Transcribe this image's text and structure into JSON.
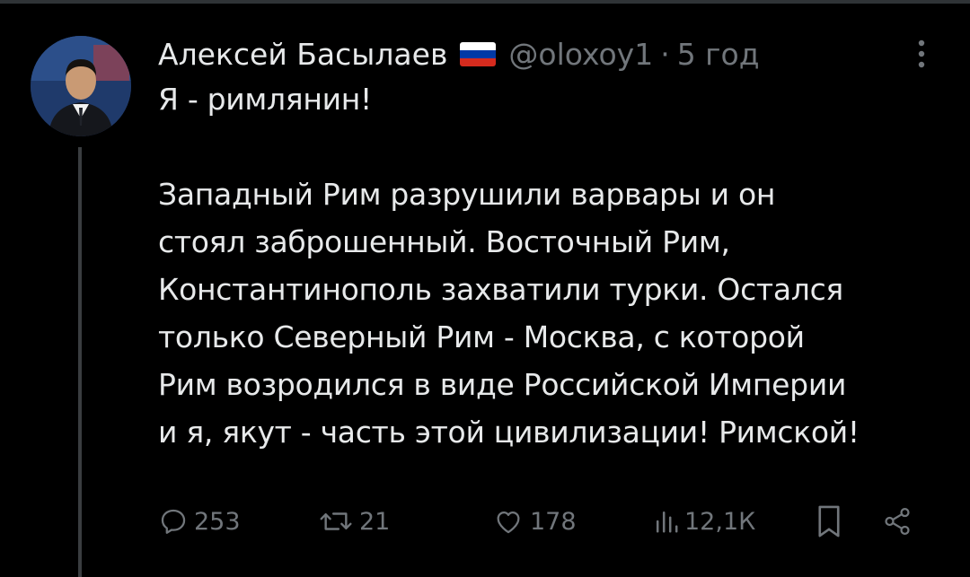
{
  "tweet": {
    "author_name": "Алексей Басылаев",
    "flag": "russia-flag",
    "handle": "@oloxoy1",
    "separator": "·",
    "time": "5 год",
    "lines": [
      "Я - римлянин!",
      "",
      "Западный Рим разрушили варвары и он",
      "стоял заброшенный. Восточный Рим,",
      "Константинополь захватили турки. Остался",
      "только Северный Рим - Москва, с которой",
      "Рим возродился в виде Российской Империи",
      "и я, якут - часть этой цивилизации! Римской!"
    ]
  },
  "actions": {
    "replies": "253",
    "reposts": "21",
    "likes": "178",
    "views": "12,1К"
  },
  "colors": {
    "background": "#000000",
    "text": "#e7e9ea",
    "muted": "#71767b",
    "flag_white": "#ffffff",
    "flag_blue": "#0039a6",
    "flag_red": "#d52b1e"
  }
}
